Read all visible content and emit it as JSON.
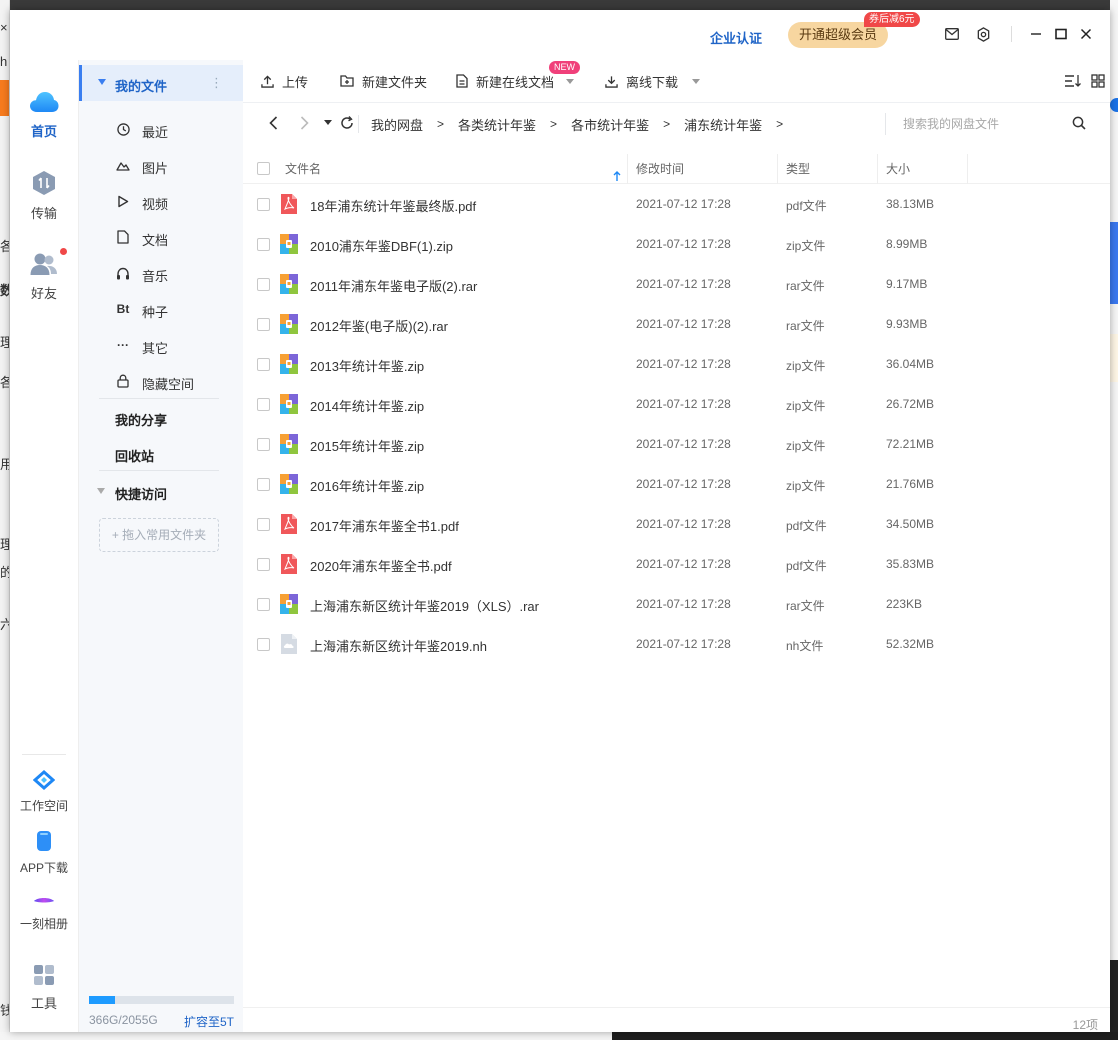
{
  "background": {
    "left_fragments": [
      "h",
      "各",
      "数",
      "理",
      "各",
      "用",
      "理",
      "的",
      "六",
      "钱"
    ]
  },
  "titlebar": {
    "enterprise": "企业认证",
    "vip_button": "开通超级会员",
    "vip_badge": "券后减6元",
    "icons": [
      "mail-icon",
      "gear-icon",
      "minimize-icon",
      "maximize-icon",
      "close-icon"
    ]
  },
  "rail": {
    "top_items": [
      {
        "label": "首页",
        "icon": "cloud-icon",
        "active": true
      },
      {
        "label": "传输",
        "icon": "transfer-icon",
        "active": false
      },
      {
        "label": "好友",
        "icon": "friends-icon",
        "active": false
      }
    ],
    "bottom_items": [
      {
        "label": "工作空间",
        "icon": "workspace-icon"
      },
      {
        "label": "APP下载",
        "icon": "phone-icon"
      },
      {
        "label": "一刻相册",
        "icon": "album-icon"
      },
      {
        "label": "工具",
        "icon": "tools-icon"
      }
    ]
  },
  "nav": {
    "my_files": "我的文件",
    "categories": [
      {
        "label": "最近",
        "icon": "clock-icon"
      },
      {
        "label": "图片",
        "icon": "image-icon"
      },
      {
        "label": "视频",
        "icon": "play-icon"
      },
      {
        "label": "文档",
        "icon": "document-icon"
      },
      {
        "label": "音乐",
        "icon": "headphones-icon"
      },
      {
        "label": "种子",
        "icon": "bt-icon",
        "glyph": "Bt"
      },
      {
        "label": "其它",
        "icon": "more-icon",
        "glyph": "···"
      },
      {
        "label": "隐藏空间",
        "icon": "lock-icon"
      }
    ],
    "my_share": "我的分享",
    "recycle": "回收站",
    "quick_access": "快捷访问",
    "drop_hint": "+ 拖入常用文件夹",
    "storage": {
      "used_text": "366G/2055G",
      "used_fraction": 0.178,
      "expand": "扩容至5T"
    }
  },
  "toolbar": {
    "upload": "上传",
    "new_folder": "新建文件夹",
    "new_doc": "新建在线文档",
    "new_badge": "NEW",
    "offline": "离线下载"
  },
  "path": {
    "crumbs": [
      "我的网盘",
      "各类统计年鉴",
      "各市统计年鉴",
      "浦东统计年鉴"
    ],
    "sep": ">",
    "search_placeholder": "搜索我的网盘文件"
  },
  "table": {
    "headers": {
      "name": "文件名",
      "modified": "修改时间",
      "type": "类型",
      "size": "大小"
    },
    "rows": [
      {
        "name": "18年浦东统计年鉴最终版.pdf",
        "date": "2021-07-12 17:28",
        "type": "pdf文件",
        "size": "38.13MB",
        "kind": "pdf"
      },
      {
        "name": "2010浦东年鉴DBF(1).zip",
        "date": "2021-07-12 17:28",
        "type": "zip文件",
        "size": "8.99MB",
        "kind": "zip"
      },
      {
        "name": "2011年浦东年鉴电子版(2).rar",
        "date": "2021-07-12 17:28",
        "type": "rar文件",
        "size": "9.17MB",
        "kind": "zip"
      },
      {
        "name": "2012年鉴(电子版)(2).rar",
        "date": "2021-07-12 17:28",
        "type": "rar文件",
        "size": "9.93MB",
        "kind": "zip"
      },
      {
        "name": "2013年统计年鉴.zip",
        "date": "2021-07-12 17:28",
        "type": "zip文件",
        "size": "36.04MB",
        "kind": "zip"
      },
      {
        "name": "2014年统计年鉴.zip",
        "date": "2021-07-12 17:28",
        "type": "zip文件",
        "size": "26.72MB",
        "kind": "zip"
      },
      {
        "name": "2015年统计年鉴.zip",
        "date": "2021-07-12 17:28",
        "type": "zip文件",
        "size": "72.21MB",
        "kind": "zip"
      },
      {
        "name": "2016年统计年鉴.zip",
        "date": "2021-07-12 17:28",
        "type": "zip文件",
        "size": "21.76MB",
        "kind": "zip"
      },
      {
        "name": "2017年浦东年鉴全书1.pdf",
        "date": "2021-07-12 17:28",
        "type": "pdf文件",
        "size": "34.50MB",
        "kind": "pdf"
      },
      {
        "name": "2020年浦东年鉴全书.pdf",
        "date": "2021-07-12 17:28",
        "type": "pdf文件",
        "size": "35.83MB",
        "kind": "pdf"
      },
      {
        "name": "上海浦东新区统计年鉴2019（XLS）.rar",
        "date": "2021-07-12 17:28",
        "type": "rar文件",
        "size": "223KB",
        "kind": "zip"
      },
      {
        "name": "上海浦东新区统计年鉴2019.nh",
        "date": "2021-07-12 17:28",
        "type": "nh文件",
        "size": "52.32MB",
        "kind": "other"
      }
    ]
  },
  "footer": {
    "count": "12项"
  },
  "colors": {
    "accent": "#1f64c7",
    "vip": "#f7d6a0",
    "badge_red": "#f04848",
    "pdf": "#f0575a"
  }
}
